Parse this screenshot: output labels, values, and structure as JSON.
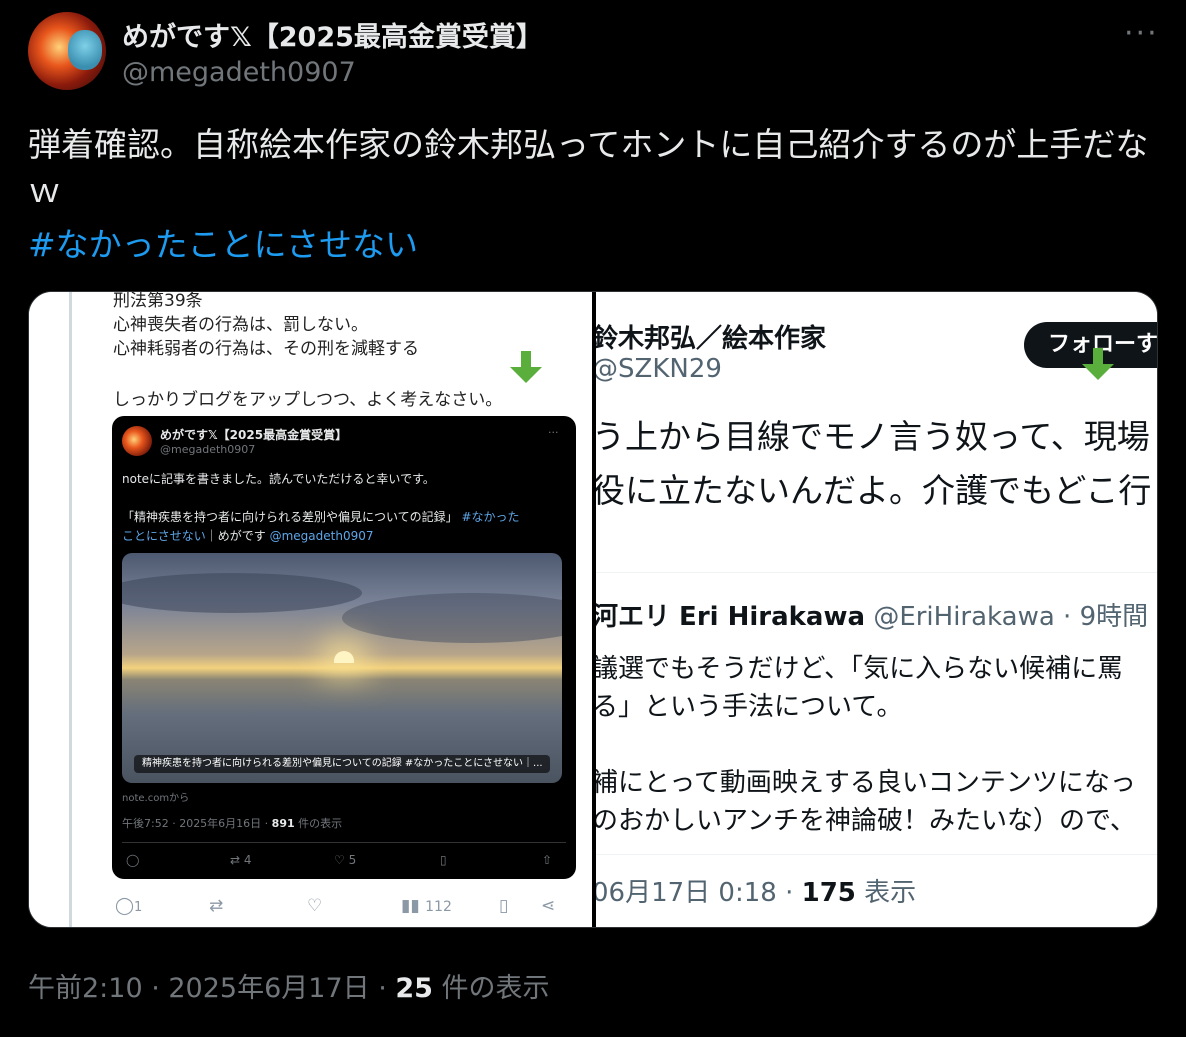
{
  "tweet": {
    "author_name": "めがです𝕏【2025最高金賞受賞】",
    "author_handle": "@megadeth0907",
    "more_icon": "more-horizontal-icon",
    "text": "弾着確認。自称絵本作家の鈴木邦弘ってホントに自己紹介するのが上手だなｗ",
    "hashtag": "#なかったことにさせない",
    "timestamp": "午前2:10 · 2025年6月17日 · ",
    "views_count": "25",
    "views_label": " 件の表示"
  },
  "left_panel": {
    "lines": [
      "刑法第39条",
      "心神喪失者の行為は、罰しない。",
      "心神耗弱者の行為は、その刑を減軽する",
      "しっかりブログをアップしつつ、よく考えなさい。"
    ],
    "embed": {
      "author_name": "めがです𝕏【2025最高金賞受賞】",
      "author_handle": "@megadeth0907",
      "more": "···",
      "text1": "noteに記事を書きました。読んでいただけると幸いです。",
      "text2": "「精神疾患を持つ者に向けられる差別や偏見についての記録」",
      "text2_tag": "#なかった",
      "text3_tag": "ことにさせない",
      "text3_rest": "｜めがです",
      "text3_mention": "@megadeth0907",
      "photo_caption": "精神疾患を持つ者に向けられる差別や偏見についての記録 #なかったことにさせない｜...",
      "source": "note.comから",
      "meta": "午後7:52 · 2025年6月16日 · ",
      "meta_views": "891",
      "meta_views_label": " 件の表示",
      "retweets": "4",
      "likes": "5"
    },
    "actions": {
      "replies": "1",
      "views": "112"
    }
  },
  "right_panel": {
    "name": "鈴木邦弘／絵本作家",
    "handle": "@SZKN29",
    "follow_label": "フォローす",
    "text1": "う上から目線でモノ言う奴って、現場",
    "text2": "役に立たないんだよ。介護でもどこ行",
    "quoted_name": "河エリ Eri Hirakawa",
    "quoted_meta": "@EriHirakawa · 9時間",
    "quoted_text1": "議選でもそうだけど、「気に入らない候補に罵",
    "quoted_text2": "る」という手法について。",
    "quoted_text3": "補にとって動画映えする良いコンテンツになっ",
    "quoted_text4": "のおかしいアンチを神論破！みたいな）ので、",
    "meta": "06月17日 0:18 · ",
    "views": "175",
    "views_label": " 表示"
  },
  "colors": {
    "background": "#000000",
    "text": "#e7e9ea",
    "muted": "#71767b",
    "link": "#1d9bf0",
    "arrow": "#5aae3c"
  }
}
